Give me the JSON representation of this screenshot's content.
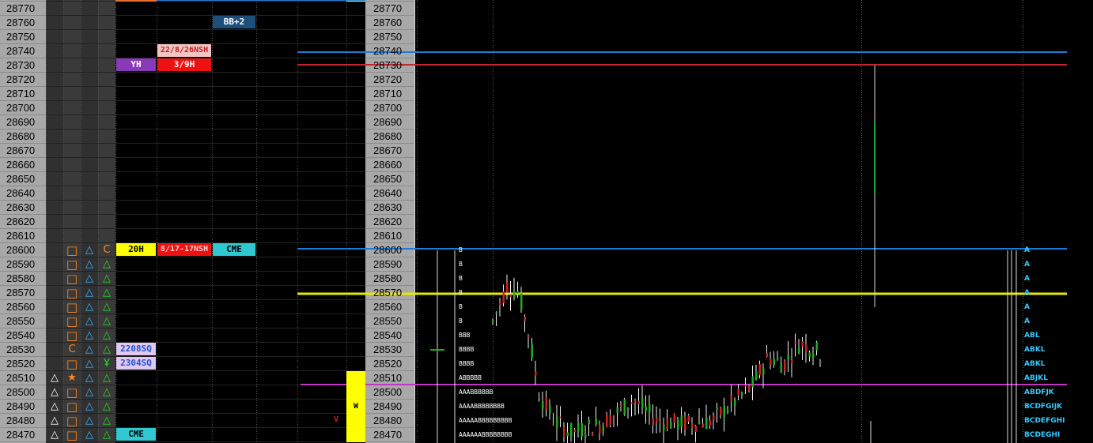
{
  "prices": [
    "28770",
    "28760",
    "28750",
    "28740",
    "28730",
    "28720",
    "28710",
    "28700",
    "28690",
    "28680",
    "28670",
    "28660",
    "28650",
    "28640",
    "28630",
    "28620",
    "28610",
    "28600",
    "28590",
    "28580",
    "28570",
    "28560",
    "28550",
    "28540",
    "28530",
    "28520",
    "28510",
    "28500",
    "28490",
    "28480",
    "28470"
  ],
  "tags": {
    "bb2": "BB+2",
    "nsh1": "22/8/26NSH",
    "yh": "YH",
    "h398": "3/9H",
    "h20": "20H",
    "nsh2": "8/17-17NSH",
    "cme1": "CME",
    "sq1": "2208SQ",
    "sq2": "2304SQ",
    "cme2": "CME",
    "w": "W",
    "v": "V"
  },
  "icon_rows": {
    "c1": [
      "",
      "",
      "",
      "",
      "",
      "",
      "",
      "",
      "",
      "",
      "",
      "",
      "",
      "",
      "",
      "",
      "",
      "",
      "",
      "",
      "",
      "",
      "",
      "",
      "",
      "",
      "triangle",
      "triangle",
      "triangle",
      "triangle",
      "triangle"
    ],
    "c2": [
      "",
      "",
      "",
      "",
      "",
      "",
      "",
      "",
      "",
      "",
      "",
      "",
      "",
      "",
      "",
      "",
      "",
      "square",
      "square",
      "square",
      "square",
      "square",
      "square",
      "square",
      "letter-c",
      "square",
      "star",
      "square",
      "square",
      "square",
      "square"
    ],
    "c3": [
      "",
      "",
      "",
      "",
      "",
      "",
      "",
      "",
      "",
      "",
      "",
      "",
      "",
      "",
      "",
      "",
      "",
      "triangle",
      "triangle",
      "triangle",
      "triangle",
      "triangle",
      "triangle",
      "triangle",
      "triangle",
      "triangle",
      "triangle",
      "triangle",
      "triangle",
      "triangle",
      "triangle"
    ],
    "c4": [
      "",
      "",
      "",
      "",
      "",
      "",
      "",
      "",
      "",
      "",
      "",
      "",
      "",
      "",
      "",
      "",
      "",
      "letter-c",
      "triangle",
      "triangle",
      "triangle",
      "triangle",
      "triangle",
      "triangle",
      "triangle",
      "yen",
      "triangle",
      "triangle",
      "triangle",
      "triangle",
      "triangle"
    ]
  },
  "icon_glyphs": {
    "triangle": "△",
    "square": "□",
    "star": "★",
    "letter-c": "C",
    "yen": "Ұ"
  },
  "icon_colors": {
    "c1": "#ffffff",
    "c2": "#ff8a1e",
    "c3": "#3cb3ff",
    "c4": "#22dd22",
    "star": "#ff8a1e",
    "letter-c": "#ff8a1e",
    "yen": "#22dd22"
  },
  "tpo_left": [
    "",
    "",
    "",
    "",
    "",
    "",
    "",
    "",
    "",
    "",
    "",
    "",
    "",
    "",
    "",
    "",
    "",
    "B",
    "B",
    "B",
    "B",
    "B",
    "B",
    "BBB",
    "BBBB",
    "BBBB",
    "ABBBBB",
    "AAABBBBBB",
    "AAAABBBBBBBB",
    "AAAAABBBBBBBBB",
    "AAAAAABBBBBBBB"
  ],
  "tpo_right": [
    "",
    "",
    "",
    "",
    "",
    "",
    "",
    "",
    "",
    "",
    "",
    "",
    "",
    "",
    "",
    "",
    "",
    "A",
    "A",
    "A",
    "A",
    "A",
    "A",
    "ABL",
    "ABKL",
    "ABKL",
    "ABJKL",
    "ABDFJK",
    "BCDFGIJK",
    "BCDEFGHI",
    "BCDEGHI"
  ],
  "lines": {
    "blue": "#1e7bd8",
    "red": "#c0262b",
    "yellow": "#e8e800",
    "magenta": "#c036c0"
  },
  "colors": {
    "up": "#22aa22",
    "down": "#cc2222",
    "wick": "#ffffff"
  }
}
